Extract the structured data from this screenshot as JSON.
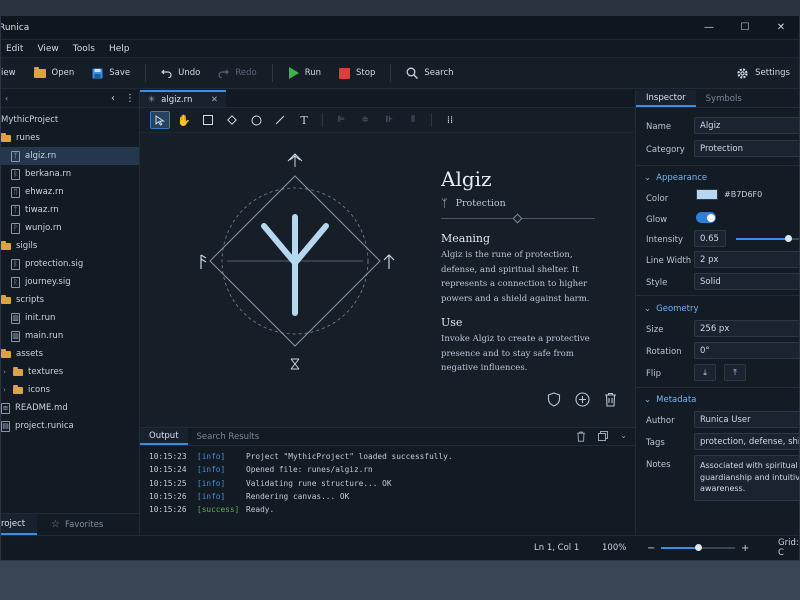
{
  "app": {
    "title": "Runica"
  },
  "menu": [
    "Edit",
    "View",
    "Tools",
    "Help"
  ],
  "toolbar": {
    "new_label": "iew",
    "open_label": "Open",
    "save_label": "Save",
    "undo_label": "Undo",
    "redo_label": "Redo",
    "run_label": "Run",
    "stop_label": "Stop",
    "search_label": "Search",
    "settings_label": "Settings"
  },
  "sidebar": {
    "project_name": "MythicProject",
    "items": [
      {
        "label": "runes",
        "type": "folder",
        "level": 0
      },
      {
        "label": "algiz.rn",
        "type": "file",
        "glyph": "ᛉ",
        "level": 1,
        "selected": true
      },
      {
        "label": "berkana.rn",
        "type": "file",
        "glyph": "ᛒ",
        "level": 1
      },
      {
        "label": "ehwaz.rn",
        "type": "file",
        "glyph": "ᛖ",
        "level": 1
      },
      {
        "label": "tiwaz.rn",
        "type": "file",
        "glyph": "ᛏ",
        "level": 1
      },
      {
        "label": "wunjo.rn",
        "type": "file",
        "glyph": "ᚹ",
        "level": 1
      },
      {
        "label": "sigils",
        "type": "folder",
        "level": 0
      },
      {
        "label": "protection.sig",
        "type": "file",
        "glyph": "ᛒ",
        "level": 1
      },
      {
        "label": "journey.sig",
        "type": "file",
        "glyph": "ᚱ",
        "level": 1
      },
      {
        "label": "scripts",
        "type": "folder",
        "level": 0
      },
      {
        "label": "init.run",
        "type": "file",
        "glyph": "▥",
        "level": 1
      },
      {
        "label": "main.run",
        "type": "file",
        "glyph": "▥",
        "level": 1
      },
      {
        "label": "assets",
        "type": "folder",
        "level": 0
      },
      {
        "label": "textures",
        "type": "folder",
        "level": 1,
        "collapsed": true
      },
      {
        "label": "icons",
        "type": "folder",
        "level": 1,
        "collapsed": true
      },
      {
        "label": "README.md",
        "type": "file",
        "glyph": "≡",
        "level": 0
      },
      {
        "label": "project.runica",
        "type": "file",
        "glyph": "▤",
        "level": 0
      }
    ],
    "tab_project": "roject",
    "tab_favorites": "Favorites"
  },
  "editor": {
    "tab_label": "algiz.rn",
    "rune": {
      "title": "Algiz",
      "subtitle": "Protection",
      "meaning_heading": "Meaning",
      "meaning_text": "Algiz is the rune of protection, defense, and spiritual shelter. It represents a connection to higher powers and a shield against harm.",
      "use_heading": "Use",
      "use_text": "Invoke Algiz to create a protective presence and to stay safe from negative influences."
    }
  },
  "output": {
    "tab_output": "Output",
    "tab_search": "Search Results",
    "logs": [
      {
        "time": "10:15:23",
        "level": "[info]",
        "msg": "Project \"MythicProject\" loaded successfully."
      },
      {
        "time": "10:15:24",
        "level": "[info]",
        "msg": "Opened file: runes/algiz.rn"
      },
      {
        "time": "10:15:25",
        "level": "[info]",
        "msg": "Validating rune structure... OK"
      },
      {
        "time": "10:15:26",
        "level": "[info]",
        "msg": "Rendering canvas... OK"
      },
      {
        "time": "10:15:26",
        "level": "[success]",
        "msg": "Ready."
      }
    ]
  },
  "inspector": {
    "tab_inspector": "Inspector",
    "tab_symbols": "Symbols",
    "name_label": "Name",
    "name_value": "Algiz",
    "category_label": "Category",
    "category_value": "Protection",
    "appearance_heading": "Appearance",
    "color_label": "Color",
    "color_value": "#B7D6F0",
    "glow_label": "Glow",
    "glow_on": true,
    "intensity_label": "Intensity",
    "intensity_value": "0.65",
    "intensity_fraction": 0.65,
    "linewidth_label": "Line Width",
    "linewidth_value": "2 px",
    "style_label": "Style",
    "style_value": "Solid",
    "geometry_heading": "Geometry",
    "size_label": "Size",
    "size_value": "256 px",
    "rotation_label": "Rotation",
    "rotation_value": "0°",
    "flip_label": "Flip",
    "metadata_heading": "Metadata",
    "author_label": "Author",
    "author_value": "Runica User",
    "tags_label": "Tags",
    "tags_value": "protection, defense, shield",
    "notes_label": "Notes",
    "notes_value": "Associated with spiritual guardianship and intuitive awareness."
  },
  "status": {
    "position": "Ln 1, Col 1",
    "zoom": "100%",
    "zoom_fraction": 0.5,
    "grid": "Grid: C"
  },
  "colors": {
    "accent": "#3a8ee6",
    "rune": "#b7d6f0",
    "folder": "#d9a441",
    "run": "#3cb44b",
    "stop": "#e03c3c"
  }
}
